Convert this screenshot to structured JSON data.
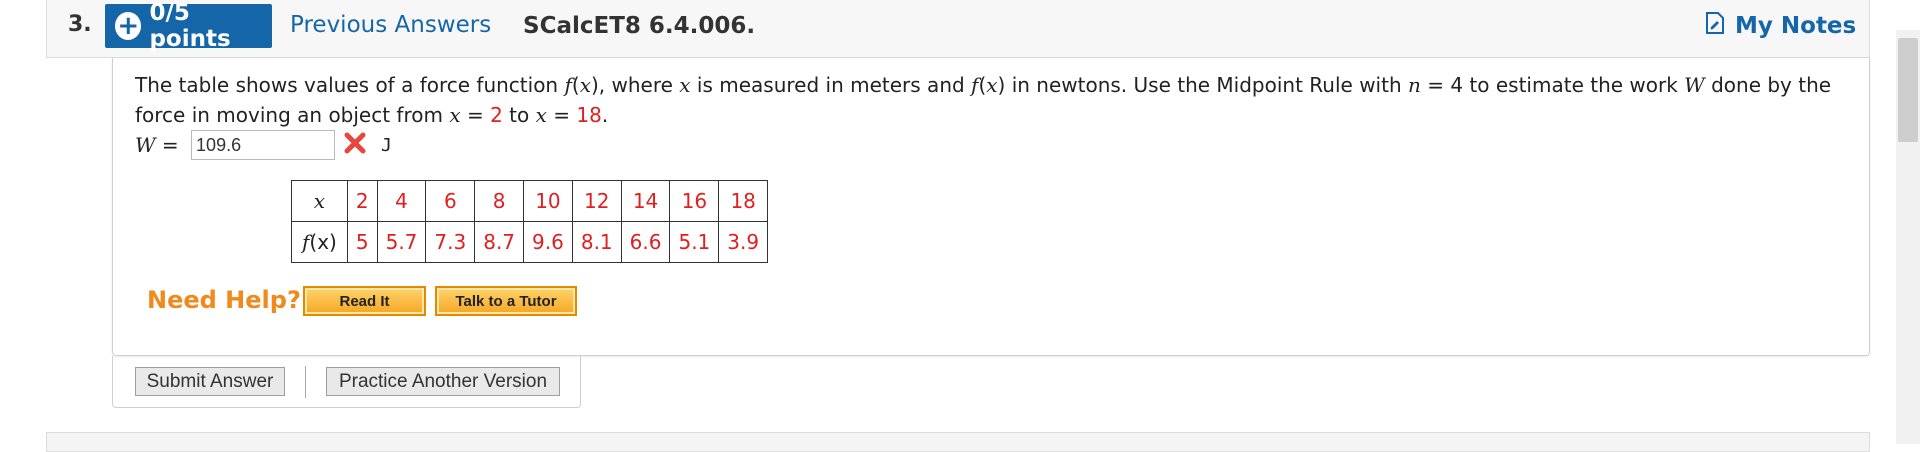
{
  "header": {
    "question_number": "3.",
    "points_label": "0/5 points",
    "previous_answers_label": "Previous Answers",
    "problem_code": "SCalcET8 6.4.006.",
    "my_notes_label": "My Notes"
  },
  "question": {
    "text_1": "The table shows values of a force function ",
    "fx_1": "f",
    "text_2": "(",
    "x_1": "x",
    "text_3": "), where ",
    "x_2": "x",
    "text_4": " is measured in meters and ",
    "fx_2": "f",
    "text_5": "(",
    "x_3": "x",
    "text_6": ") in newtons. Use the Midpoint Rule with ",
    "n_var": "n",
    "text_7": " = 4 to estimate the work ",
    "w_var": "W",
    "text_8": " done by the force in moving an object from ",
    "x_4": "x",
    "text_9": " = ",
    "from_value": "2",
    "text_10": " to ",
    "x_5": "x",
    "text_11": " = ",
    "to_value": "18",
    "text_12": "."
  },
  "answer": {
    "variable": "W",
    "equals": " = ",
    "value": "109.6",
    "status": "incorrect",
    "unit": "J"
  },
  "table": {
    "x_header": "x",
    "fx_header_f": "f",
    "fx_header_rest": "(x)",
    "x_values": [
      "2",
      "4",
      "6",
      "8",
      "10",
      "12",
      "14",
      "16",
      "18"
    ],
    "fx_values": [
      "5",
      "5.7",
      "7.3",
      "8.7",
      "9.6",
      "8.1",
      "6.6",
      "5.1",
      "3.9"
    ]
  },
  "help": {
    "need_help_label": "Need Help?",
    "read_it_label": "Read It",
    "talk_tutor_label": "Talk to a Tutor"
  },
  "actions": {
    "submit_label": "Submit Answer",
    "practice_label": "Practice Another Version"
  },
  "colors": {
    "accent_blue": "#1566a8",
    "error_red": "#e02020",
    "help_orange": "#f08a1c"
  },
  "icons": {
    "points": "plus-circle-icon",
    "notes": "notes-edit-icon",
    "wrong": "red-x-icon"
  }
}
